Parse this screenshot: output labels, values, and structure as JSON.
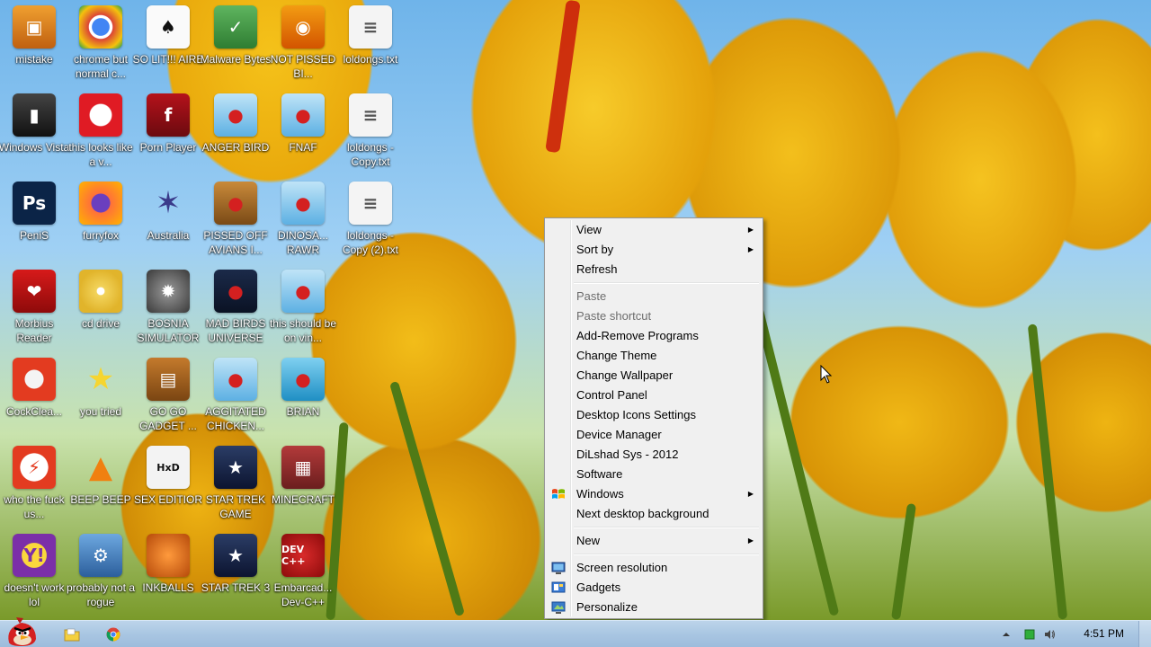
{
  "desktop": {
    "icons": [
      {
        "label": "mistake",
        "icon": "file-icon"
      },
      {
        "label": "chrome but normal c...",
        "icon": "chrome-icon"
      },
      {
        "label": "SO LIT!!! AIRE",
        "icon": "playing-card-icon"
      },
      {
        "label": "Malware Bytes",
        "icon": "shield-icon"
      },
      {
        "label": "NOT PISSED BI...",
        "icon": "angry-pig-icon"
      },
      {
        "label": "loldongs.txt",
        "icon": "text-file-icon"
      },
      {
        "label": "Windows Vista",
        "icon": "trash-can-icon"
      },
      {
        "label": "this looks like a v...",
        "icon": "opera-icon"
      },
      {
        "label": "Porn Player",
        "icon": "flash-icon"
      },
      {
        "label": "ANGER BIRD",
        "icon": "angry-bird-icon"
      },
      {
        "label": "FNAF",
        "icon": "angry-bird-icon"
      },
      {
        "label": "loldongs - Copy.txt",
        "icon": "text-file-icon"
      },
      {
        "label": "PeniS",
        "icon": "photoshop-icon"
      },
      {
        "label": "furryfox",
        "icon": "firefox-icon"
      },
      {
        "label": "Australia",
        "icon": "spider-icon"
      },
      {
        "label": "PISSED OFF AVIANS I...",
        "icon": "angry-birds-seasons-icon"
      },
      {
        "label": "DINOSA... RAWR",
        "icon": "angry-bird-icon"
      },
      {
        "label": "loldongs - Copy (2).txt",
        "icon": "text-file-icon"
      },
      {
        "label": "Morbius Reader",
        "icon": "adobe-reader-icon"
      },
      {
        "label": "cd drive",
        "icon": "cd-icon"
      },
      {
        "label": "BOSNIA SIMULATOR",
        "icon": "spiked-ball-icon"
      },
      {
        "label": "MAD BIRDS UNIVERSE",
        "icon": "angry-birds-space-icon"
      },
      {
        "label": "this should be on vin...",
        "icon": "angry-bird-icon"
      },
      {
        "label": "CockClea...",
        "icon": "ccleaner-icon"
      },
      {
        "label": "you tried",
        "icon": "star-icon"
      },
      {
        "label": "GO GO GADGET ...",
        "icon": "briefcase-icon"
      },
      {
        "label": "AGGITATED CHICKEN...",
        "icon": "angry-bird-icon"
      },
      {
        "label": "BRIAN",
        "icon": "angry-birds-rio-icon"
      },
      {
        "label": "who the fuck us...",
        "icon": "winamp-icon"
      },
      {
        "label": "BEEP BEEP",
        "icon": "vlc-cone-icon"
      },
      {
        "label": "SEX EDITIOR",
        "icon": "hxd-icon"
      },
      {
        "label": "STAR TREK GAME",
        "icon": "angry-birds-star-wars-icon"
      },
      {
        "label": "MINECRAFT",
        "icon": "minecraft-icon"
      },
      {
        "label": "doesn't work lol",
        "icon": "yahoo-messenger-icon"
      },
      {
        "label": "probably not a rogue",
        "icon": "monitor-gears-icon"
      },
      {
        "label": "INKBALLS",
        "icon": "inkball-icon"
      },
      {
        "label": "STAR TREK 3",
        "icon": "angry-birds-star-wars-icon"
      },
      {
        "label": "Embarcad... Dev-C++",
        "icon": "dev-cpp-icon"
      }
    ]
  },
  "context_menu": {
    "items": [
      {
        "label": "View",
        "submenu": true,
        "disabled": false
      },
      {
        "label": "Sort by",
        "submenu": true,
        "disabled": false
      },
      {
        "label": "Refresh",
        "submenu": false,
        "disabled": false
      },
      {
        "separator": true
      },
      {
        "label": "Paste",
        "submenu": false,
        "disabled": true
      },
      {
        "label": "Paste shortcut",
        "submenu": false,
        "disabled": true
      },
      {
        "label": "Add-Remove Programs",
        "submenu": false,
        "disabled": false
      },
      {
        "label": "Change Theme",
        "submenu": false,
        "disabled": false
      },
      {
        "label": "Change Wallpaper",
        "submenu": false,
        "disabled": false
      },
      {
        "label": "Control Panel",
        "submenu": false,
        "disabled": false
      },
      {
        "label": "Desktop Icons Settings",
        "submenu": false,
        "disabled": false
      },
      {
        "label": "Device Manager",
        "submenu": false,
        "disabled": false
      },
      {
        "label": "DiLshad Sys - 2012",
        "submenu": false,
        "disabled": false
      },
      {
        "label": "Software",
        "submenu": false,
        "disabled": false
      },
      {
        "label": "Windows",
        "submenu": true,
        "disabled": false,
        "icon": "windows-flag-icon"
      },
      {
        "label": "Next desktop background",
        "submenu": false,
        "disabled": false
      },
      {
        "separator": true
      },
      {
        "label": "New",
        "submenu": true,
        "disabled": false
      },
      {
        "separator": true
      },
      {
        "label": "Screen resolution",
        "submenu": false,
        "disabled": false,
        "icon": "monitor-icon"
      },
      {
        "label": "Gadgets",
        "submenu": false,
        "disabled": false,
        "icon": "gadgets-icon"
      },
      {
        "label": "Personalize",
        "submenu": false,
        "disabled": false,
        "icon": "personalize-icon"
      }
    ]
  },
  "taskbar": {
    "start_icon": "angry-bird-start-icon",
    "pinned": [
      {
        "name": "explorer",
        "icon": "folder-icon"
      },
      {
        "name": "chrome",
        "icon": "chrome-icon"
      }
    ],
    "tray_icons": [
      "chevron-up-icon",
      "network-icon",
      "speaker-icon"
    ],
    "clock": "4:51 PM"
  },
  "colors": {
    "menu_bg": "#f0f0f0",
    "menu_disabled_text": "#6d6d6d",
    "taskbar_bg": "#a9c6e2",
    "icon_label_text": "#ffffff"
  }
}
